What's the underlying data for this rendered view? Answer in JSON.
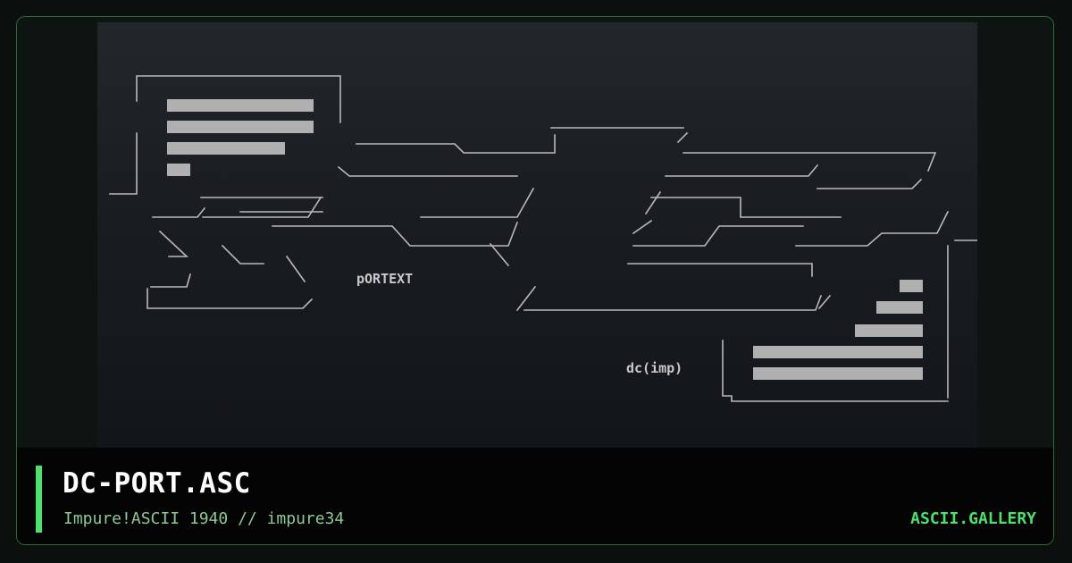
{
  "card": {
    "title": "DC-PORT.ASC",
    "subtitle": "Impure!ASCII 1940 // impure34",
    "brand": "ASCII.GALLERY"
  },
  "art": {
    "label_left": "pORTEXT",
    "label_right": "dc(imp)"
  },
  "colors": {
    "accent": "#4ee06a",
    "border": "#2c6b34",
    "subtitle": "#8ec896",
    "art_ink": "#c9c9c9"
  }
}
